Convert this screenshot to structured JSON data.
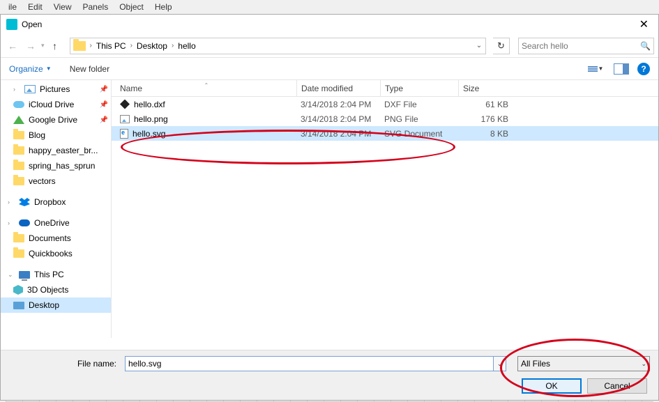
{
  "app_menu": [
    "ile",
    "Edit",
    "View",
    "Panels",
    "Object",
    "Help"
  ],
  "dialog": {
    "title": "Open"
  },
  "nav": {
    "breadcrumb": [
      "This PC",
      "Desktop",
      "hello"
    ],
    "search_placeholder": "Search hello"
  },
  "toolbar": {
    "organize": "Organize",
    "new_folder": "New folder"
  },
  "sidebar": {
    "items": [
      {
        "icon": "pictures",
        "label": "Pictures",
        "pinned": true,
        "expandable": true
      },
      {
        "icon": "icloud",
        "label": "iCloud Drive",
        "pinned": true
      },
      {
        "icon": "gdrive",
        "label": "Google Drive",
        "pinned": true
      },
      {
        "icon": "folder",
        "label": "Blog"
      },
      {
        "icon": "folder",
        "label": "happy_easter_br..."
      },
      {
        "icon": "folder",
        "label": "spring_has_sprun"
      },
      {
        "icon": "folder",
        "label": "vectors"
      }
    ],
    "groups": [
      {
        "icon": "dropbox",
        "label": "Dropbox",
        "expandable": true
      },
      {
        "icon": "onedrive",
        "label": "OneDrive",
        "expandable": true,
        "children": [
          {
            "icon": "folder",
            "label": "Documents"
          },
          {
            "icon": "folder",
            "label": "Quickbooks"
          }
        ]
      },
      {
        "icon": "pc",
        "label": "This PC",
        "expandable": true,
        "children": [
          {
            "icon": "3d",
            "label": "3D Objects"
          },
          {
            "icon": "desktop",
            "label": "Desktop",
            "selected": true
          }
        ]
      }
    ]
  },
  "columns": {
    "name": "Name",
    "date": "Date modified",
    "type": "Type",
    "size": "Size"
  },
  "files": [
    {
      "icon": "dxf",
      "name": "hello.dxf",
      "date": "3/14/2018 2:04 PM",
      "type": "DXF File",
      "size": "61 KB",
      "selected": false
    },
    {
      "icon": "png",
      "name": "hello.png",
      "date": "3/14/2018 2:04 PM",
      "type": "PNG File",
      "size": "176 KB",
      "selected": false
    },
    {
      "icon": "svg",
      "name": "hello.svg",
      "date": "3/14/2018 2:04 PM",
      "type": "SVG Document",
      "size": "8 KB",
      "selected": true
    }
  ],
  "footer": {
    "file_name_label": "File name:",
    "file_name_value": "hello.svg",
    "filter": "All Files",
    "ok": "OK",
    "cancel": "Cancel"
  }
}
